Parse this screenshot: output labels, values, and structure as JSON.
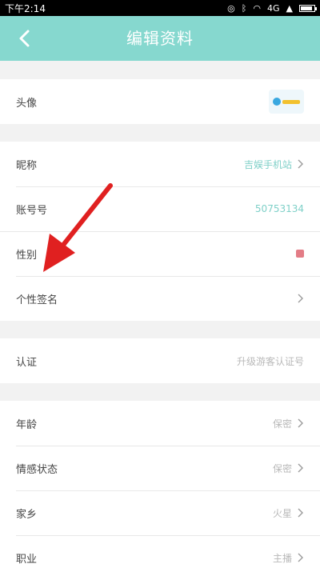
{
  "status_bar": {
    "time": "下午2:14",
    "network_label": "4G"
  },
  "nav": {
    "title": "编辑资料"
  },
  "profile": {
    "avatar_label": "头像",
    "nickname_label": "昵称",
    "nickname_value": "吉娱手机站",
    "id_label": "账号号",
    "id_value": "50753134",
    "gender_label": "性别",
    "signature_label": "个性签名"
  },
  "auth": {
    "label": "认证",
    "value": "升级游客认证号"
  },
  "details": {
    "age_label": "年龄",
    "age_value": "保密",
    "emotion_label": "情感状态",
    "emotion_value": "保密",
    "hometown_label": "家乡",
    "hometown_value": "火星",
    "job_label": "职业",
    "job_value": "主播"
  },
  "colors": {
    "accent": "#86d8cf",
    "teal_text": "#7fd0c8",
    "gender": "#e37c86",
    "arrow": "#e02020"
  },
  "icons": [
    "back-arrow-icon",
    "chevron-right-icon",
    "wifi-icon",
    "signal-icon",
    "battery-icon",
    "bluetooth-icon",
    "alarm-icon"
  ]
}
